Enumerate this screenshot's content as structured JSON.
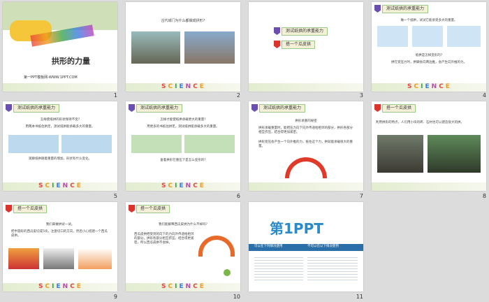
{
  "slides": [
    {
      "n": "1",
      "title": "拱形的力量",
      "subtitle": "第一PPT模板网-WWW.1PPT.COM"
    },
    {
      "n": "2",
      "caption": "古代城门为什么都做成拱形?"
    },
    {
      "n": "3",
      "items": [
        "测试纸拱的承重能力",
        "搭一个瓜皮拱"
      ]
    },
    {
      "n": "4",
      "header": "测试纸拱的承重能力",
      "text1": "做一个纸拱，试试它能承受多大的重量。",
      "text2": "纸拱是怎样变形的?",
      "text3": "拱在受压力时，拱脚会向两边推，会产生向外推的力。"
    },
    {
      "n": "5",
      "header": "测试纸拱的承重能力",
      "text1": "怎样使纸拱的形状保持不变?",
      "text2": "用两本书抵住拱足，测试纸拱能承载多大的重量。",
      "text3": "观察纸拱随着重量的增加，形状有什么变化。"
    },
    {
      "n": "6",
      "header": "测试纸拱的承重能力",
      "text1": "怎样才能使纸拱承载更大的重量?",
      "text2": "用更多的书抵住拱足，测试纸拱能承载多大的重量。",
      "text3": "垂着拱形在重压下是怎么变形的?"
    },
    {
      "n": "7",
      "header": "测试纸拱的承重能力",
      "text1": "拱形承重的秘密",
      "text2": "拱形承载重量时，能把压力向下向外传递给相邻的部分，拱形各部分相互挤压，结合得更加紧密。",
      "text3": "拱形受压会产生一个向外推的力，抵住这个力，拱就能承载很大的重量。"
    },
    {
      "n": "8",
      "header": "搭一个瓜皮拱",
      "text1": "利用拱形的特点，人们用小块的砖、石材也可以建造很大的拱。"
    },
    {
      "n": "9",
      "header": "搭一个瓜皮拱",
      "text1": "我们来做拱试一试。",
      "text2": "把半圆形的西瓜皮切成5块，注意切口的方向，然后小心搭建一个西瓜皮拱。"
    },
    {
      "n": "10",
      "header": "搭一个瓜皮拱",
      "text1": "我们能解释西瓜皮拱为什么不掉吗?",
      "text2": "西瓜皮拱把受到的向下的力向外传递给相邻的部分，拱形各部分相互挤压，结合得更紧密，所以西瓜皮拱不会掉。"
    },
    {
      "n": "11",
      "logo": "第1PPT",
      "col1": "可以在下列情况使用",
      "col2": "不可以在以下情况使用"
    }
  ],
  "science_letters": [
    "S",
    "C",
    "I",
    "E",
    "N",
    "C",
    "E"
  ],
  "science_colors": [
    "#e8453c",
    "#f29a1a",
    "#3aa64a",
    "#3b7de0",
    "#c23fbf",
    "#e8453c",
    "#f29a1a"
  ]
}
